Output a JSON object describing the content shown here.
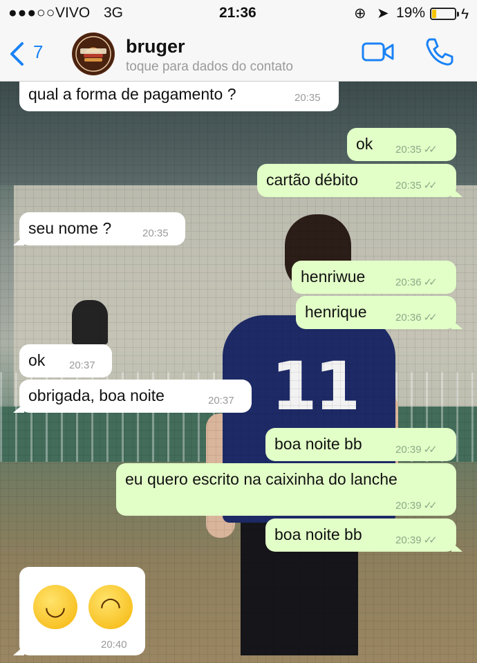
{
  "status_bar": {
    "signal": "●●●○○",
    "carrier": "VIVO",
    "network": "3G",
    "time": "21:36",
    "battery_percent": "19%",
    "battery_level": 0.19
  },
  "header": {
    "back_count": "7",
    "contact_name": "bruger",
    "contact_subtitle": "toque para dados do contato",
    "avatar_text": "CENTRO BURGER PUB"
  },
  "messages": [
    {
      "dir": "in",
      "text": "qual a forma de pagamento ?",
      "time": "20:35"
    },
    {
      "dir": "out",
      "text": "ok",
      "time": "20:35"
    },
    {
      "dir": "out",
      "text": "cartão débito",
      "time": "20:35"
    },
    {
      "dir": "in",
      "text": "seu nome ?",
      "time": "20:35"
    },
    {
      "dir": "out",
      "text": "henriwue",
      "time": "20:36"
    },
    {
      "dir": "out",
      "text": "henrique",
      "time": "20:36"
    },
    {
      "dir": "in",
      "text": "ok",
      "time": "20:37"
    },
    {
      "dir": "in",
      "text": "obrigada, boa noite",
      "time": "20:37"
    },
    {
      "dir": "out",
      "text": "boa noite bb",
      "time": "20:39"
    },
    {
      "dir": "out",
      "text": "eu quero escrito na caixinha do lanche",
      "time": "20:39"
    },
    {
      "dir": "out",
      "text": "boa noite bb",
      "time": "20:39"
    },
    {
      "dir": "in",
      "text": "",
      "time": "20:40",
      "emojis": [
        "grinning-sweat-emoji",
        "rolling-laughing-emoji"
      ]
    }
  ],
  "background": {
    "jersey_number": "11"
  },
  "colors": {
    "accent": "#1a82f5",
    "bubble_out": "#e2ffc7",
    "bubble_in": "#ffffff",
    "battery": "#f4c400"
  }
}
